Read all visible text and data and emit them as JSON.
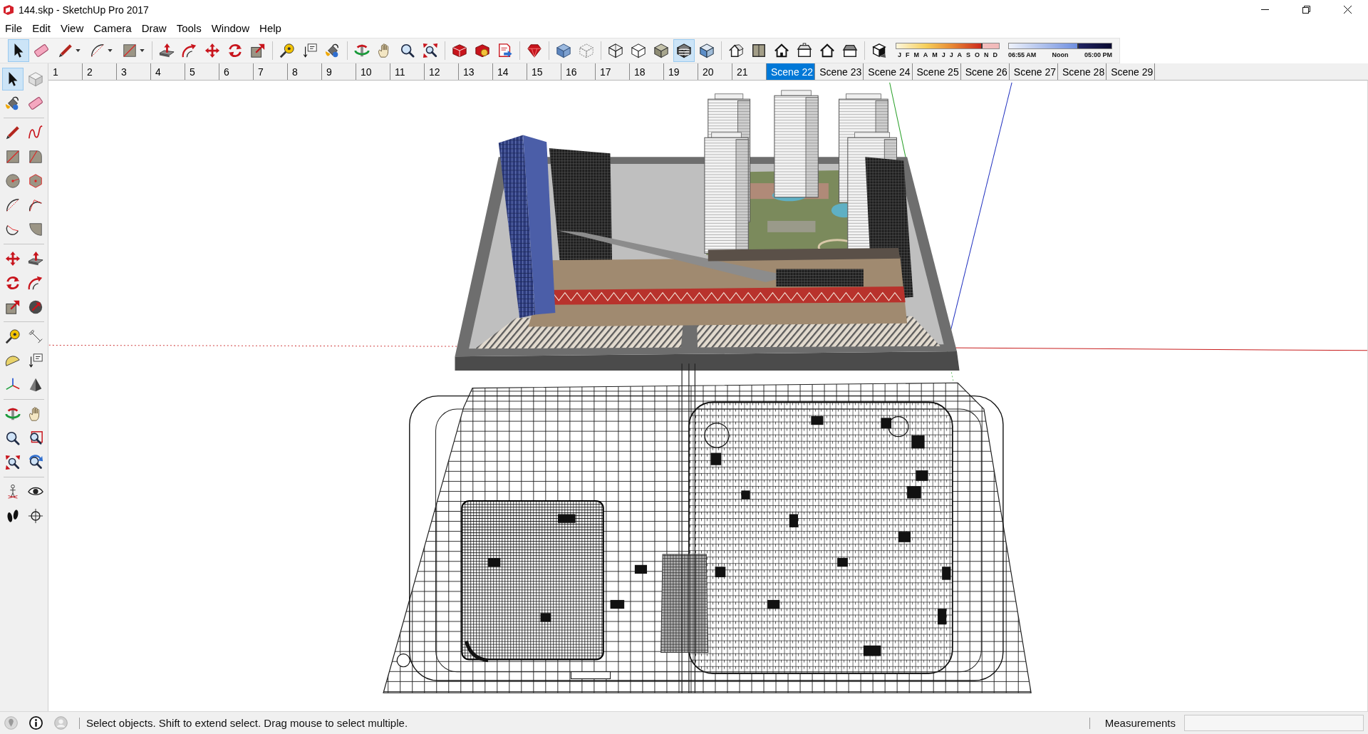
{
  "window": {
    "title": "144.skp - SketchUp Pro 2017"
  },
  "menu": [
    "File",
    "Edit",
    "View",
    "Camera",
    "Draw",
    "Tools",
    "Window",
    "Help"
  ],
  "toolbar": {
    "groups": [
      [
        {
          "kind": "select",
          "selected": true
        },
        {
          "kind": "eraser",
          "selected": false
        },
        {
          "kind": "pencil",
          "selected": false
        },
        {
          "kind": "arc",
          "selected": false
        },
        {
          "kind": "rectangle",
          "selected": false
        }
      ],
      [
        {
          "kind": "pushpull",
          "selected": false
        },
        {
          "kind": "followme",
          "selected": false
        },
        {
          "kind": "move",
          "selected": false
        },
        {
          "kind": "rotate",
          "selected": false
        },
        {
          "kind": "scale",
          "selected": false
        }
      ],
      [
        {
          "kind": "tape",
          "selected": false
        },
        {
          "kind": "text",
          "selected": false
        },
        {
          "kind": "paint",
          "selected": false
        }
      ],
      [
        {
          "kind": "orbit",
          "selected": false
        },
        {
          "kind": "pan",
          "selected": false
        },
        {
          "kind": "zoom",
          "selected": false
        },
        {
          "kind": "zoomextents",
          "selected": false
        }
      ],
      [
        {
          "kind": "warehouse",
          "selected": false
        },
        {
          "kind": "extensionwarehouse",
          "selected": false
        },
        {
          "kind": "layout",
          "selected": false
        }
      ],
      [
        {
          "kind": "extensionmanager",
          "selected": false
        }
      ],
      [
        {
          "kind": "xray",
          "selected": false
        },
        {
          "kind": "backedges",
          "selected": false
        }
      ],
      [
        {
          "kind": "wireframe",
          "selected": false
        },
        {
          "kind": "hiddenline",
          "selected": false
        },
        {
          "kind": "shaded",
          "selected": false
        },
        {
          "kind": "textured",
          "selected": true
        },
        {
          "kind": "monochrome",
          "selected": false
        }
      ],
      [
        {
          "kind": "iso",
          "selected": false
        },
        {
          "kind": "top",
          "selected": false
        },
        {
          "kind": "front",
          "selected": false
        },
        {
          "kind": "right",
          "selected": false
        },
        {
          "kind": "back",
          "selected": false
        },
        {
          "kind": "left",
          "selected": false
        }
      ],
      [
        {
          "kind": "shadows",
          "selected": false
        }
      ]
    ]
  },
  "shadow_settings": {
    "month_slider": {
      "level": 0.84
    },
    "months": [
      "J",
      "F",
      "M",
      "A",
      "M",
      "J",
      "J",
      "A",
      "S",
      "O",
      "N",
      "D"
    ],
    "time_slider": {
      "level": 0.68
    },
    "time_labels": [
      "06:55 AM",
      "Noon",
      "05:00 PM"
    ]
  },
  "scene_tabs": [
    {
      "label": "1",
      "selected": false
    },
    {
      "label": "2",
      "selected": false
    },
    {
      "label": "3",
      "selected": false
    },
    {
      "label": "4",
      "selected": false
    },
    {
      "label": "5",
      "selected": false
    },
    {
      "label": "6",
      "selected": false
    },
    {
      "label": "7",
      "selected": false
    },
    {
      "label": "8",
      "selected": false
    },
    {
      "label": "9",
      "selected": false
    },
    {
      "label": "10",
      "selected": false
    },
    {
      "label": "11",
      "selected": false
    },
    {
      "label": "12",
      "selected": false
    },
    {
      "label": "13",
      "selected": false
    },
    {
      "label": "14",
      "selected": false
    },
    {
      "label": "15",
      "selected": false
    },
    {
      "label": "16",
      "selected": false
    },
    {
      "label": "17",
      "selected": false
    },
    {
      "label": "18",
      "selected": false
    },
    {
      "label": "19",
      "selected": false
    },
    {
      "label": "20",
      "selected": false
    },
    {
      "label": "21",
      "selected": false
    },
    {
      "label": "Scene 22",
      "selected": true
    },
    {
      "label": "Scene 23",
      "selected": false
    },
    {
      "label": "Scene 24",
      "selected": false
    },
    {
      "label": "Scene 25",
      "selected": false
    },
    {
      "label": "Scene 26",
      "selected": false
    },
    {
      "label": "Scene 27",
      "selected": false
    },
    {
      "label": "Scene 28",
      "selected": false
    },
    {
      "label": "Scene 29",
      "selected": false
    }
  ],
  "tool_palette": {
    "groups": [
      [
        {
          "kind": "select",
          "selected": true
        },
        {
          "kind": "component",
          "selected": false
        },
        {
          "kind": "paint",
          "selected": false
        },
        {
          "kind": "eraser",
          "selected": false
        }
      ],
      [
        {
          "kind": "pencil",
          "selected": false
        },
        {
          "kind": "freehand",
          "selected": false
        },
        {
          "kind": "rectangle",
          "selected": false
        },
        {
          "kind": "rotatedrectangle",
          "selected": false
        },
        {
          "kind": "circle",
          "selected": false
        },
        {
          "kind": "polygon",
          "selected": false
        },
        {
          "kind": "arc",
          "selected": false
        },
        {
          "kind": "arc2",
          "selected": false
        },
        {
          "kind": "arc3",
          "selected": false
        },
        {
          "kind": "pie",
          "selected": false
        }
      ],
      [
        {
          "kind": "move",
          "selected": false
        },
        {
          "kind": "pushpull",
          "selected": false
        },
        {
          "kind": "rotate",
          "selected": false
        },
        {
          "kind": "followme",
          "selected": false
        },
        {
          "kind": "scale",
          "selected": false
        },
        {
          "kind": "offset",
          "selected": false
        }
      ],
      [
        {
          "kind": "tape",
          "selected": false
        },
        {
          "kind": "dimension",
          "selected": false
        },
        {
          "kind": "protractor",
          "selected": false
        },
        {
          "kind": "text",
          "selected": false
        },
        {
          "kind": "axes",
          "selected": false
        },
        {
          "kind": "text3d",
          "selected": false
        }
      ],
      [
        {
          "kind": "orbit",
          "selected": false
        },
        {
          "kind": "pan",
          "selected": false
        },
        {
          "kind": "zoom",
          "selected": false
        },
        {
          "kind": "zoomwindow",
          "selected": false
        },
        {
          "kind": "zoomextents",
          "selected": false
        },
        {
          "kind": "previous",
          "selected": false
        }
      ],
      [
        {
          "kind": "positioncamera",
          "selected": false
        },
        {
          "kind": "lookaround",
          "selected": false
        },
        {
          "kind": "walk",
          "selected": false
        },
        {
          "kind": "section",
          "selected": false
        }
      ]
    ]
  },
  "status_bar": {
    "message": "Select objects. Shift to extend select. Drag mouse to select multiple.",
    "measurements_label": "Measurements"
  }
}
